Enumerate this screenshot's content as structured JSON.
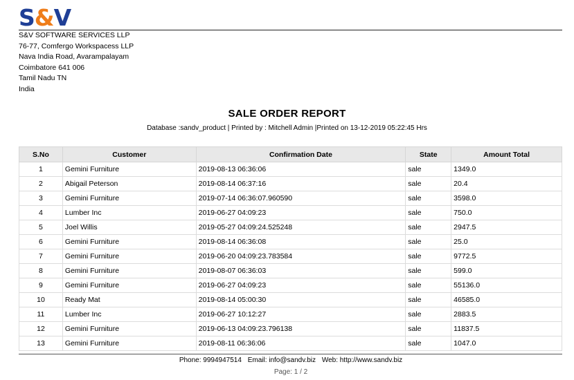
{
  "logo": {
    "s": "S",
    "amp": "&",
    "v": "V"
  },
  "company": {
    "name": "S&V SOFTWARE SERVICES LLP",
    "line1": "76-77, Comfergo Workspacess LLP",
    "line2": "Nava India Road, Avarampalayam",
    "line3": "Coimbatore 641 006",
    "line4": "Tamil Nadu TN",
    "line5": "India"
  },
  "report": {
    "title": "SALE ORDER REPORT",
    "subtitle": "Database :sandv_product | Printed by : Mitchell Admin |Printed on 13-12-2019 05:22:45 Hrs"
  },
  "table": {
    "headers": [
      "S.No",
      "Customer",
      "Confirmation Date",
      "State",
      "Amount Total"
    ],
    "rows": [
      [
        "1",
        "Gemini Furniture",
        "2019-08-13 06:36:06",
        "sale",
        "1349.0"
      ],
      [
        "2",
        "Abigail Peterson",
        "2019-08-14 06:37:16",
        "sale",
        "20.4"
      ],
      [
        "3",
        "Gemini Furniture",
        "2019-07-14 06:36:07.960590",
        "sale",
        "3598.0"
      ],
      [
        "4",
        "Lumber Inc",
        "2019-06-27 04:09:23",
        "sale",
        "750.0"
      ],
      [
        "5",
        "Joel Willis",
        "2019-05-27 04:09:24.525248",
        "sale",
        "2947.5"
      ],
      [
        "6",
        "Gemini Furniture",
        "2019-08-14 06:36:08",
        "sale",
        "25.0"
      ],
      [
        "7",
        "Gemini Furniture",
        "2019-06-20 04:09:23.783584",
        "sale",
        "9772.5"
      ],
      [
        "8",
        "Gemini Furniture",
        "2019-08-07 06:36:03",
        "sale",
        "599.0"
      ],
      [
        "9",
        "Gemini Furniture",
        "2019-06-27 04:09:23",
        "sale",
        "55136.0"
      ],
      [
        "10",
        "Ready Mat",
        "2019-08-14 05:00:30",
        "sale",
        "46585.0"
      ],
      [
        "11",
        "Lumber Inc",
        "2019-06-27 10:12:27",
        "sale",
        "2883.5"
      ],
      [
        "12",
        "Gemini Furniture",
        "2019-06-13 04:09:23.796138",
        "sale",
        "11837.5"
      ],
      [
        "13",
        "Gemini Furniture",
        "2019-08-11 06:36:06",
        "sale",
        "1047.0"
      ]
    ]
  },
  "footer": {
    "phone": "Phone: 9994947514",
    "email": "Email: info@sandv.biz",
    "web": "Web: http://www.sandv.biz",
    "page": "Page: 1 / 2"
  },
  "colors": {
    "logo_blue": "#1f3f96",
    "logo_orange": "#ef7d1a",
    "header_bg": "#e8e8e8"
  }
}
